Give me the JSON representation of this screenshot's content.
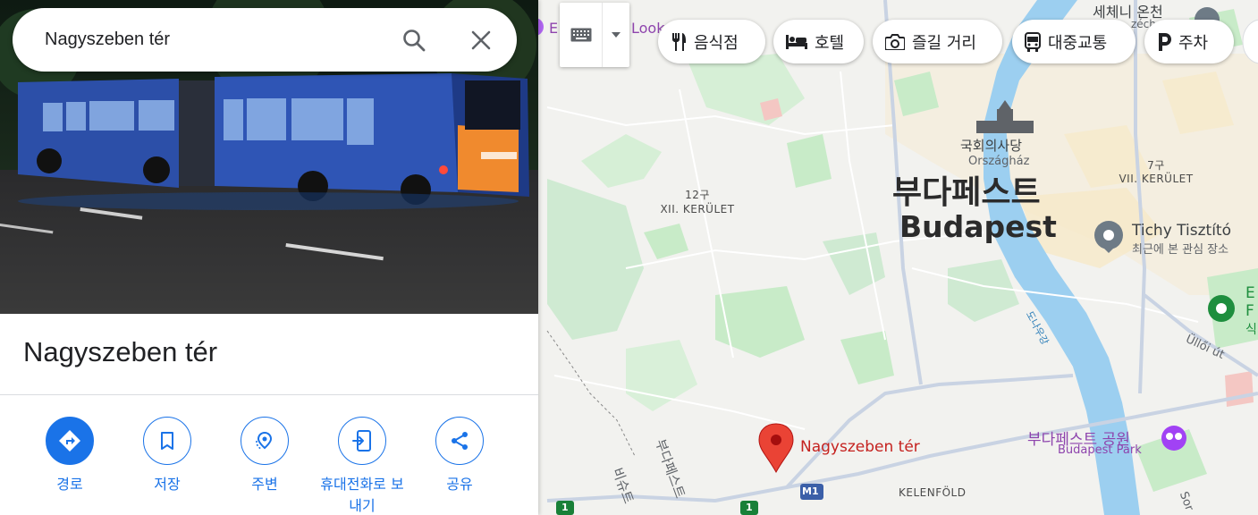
{
  "search": {
    "value": "Nagyszeben tér"
  },
  "place": {
    "title": "Nagyszeben tér"
  },
  "actions": [
    {
      "label": "경로"
    },
    {
      "label": "저장"
    },
    {
      "label": "주변"
    },
    {
      "label": "휴대전화로 보\n내기"
    },
    {
      "label": "공유"
    }
  ],
  "chips": [
    {
      "label": "음식점",
      "icon": "fork-knife-icon"
    },
    {
      "label": "호텔",
      "icon": "bed-icon"
    },
    {
      "label": "즐길 거리",
      "icon": "camera-icon"
    },
    {
      "label": "대중교통",
      "icon": "bus-icon"
    },
    {
      "label": "주차",
      "icon": "parking-icon"
    }
  ],
  "map": {
    "top_left_purple": "E",
    "top_left_purple2": "Look",
    "district_12_num": "12구",
    "district_12": "XII. KERÜLET",
    "district_7_num": "7구",
    "district_7": "VII. KERÜLET",
    "city_ko": "부다페스트",
    "city_en": "Budapest",
    "parliament_ko": "국회의사당",
    "parliament_hu": "Országház",
    "szechenyi": "세체니 온천",
    "szechenyi_sub": "zécho",
    "tichy": "Tichy Tisztító",
    "tichy_sub": "최근에 본 관심 장소",
    "park_ko": "부다페스트 공원",
    "park_en": "Budapest Park",
    "river": "도나우강",
    "ulloi": "Üllői út",
    "kelenfold": "KELENFÖLD",
    "motorway": "M1",
    "route1": "1",
    "pin_label": "Nagyszeben tér",
    "right_edge_1": "E",
    "right_edge_2": "F",
    "right_edge_3": "식",
    "soroksari": "Sor",
    "budaors_1": "부다페스트",
    "budaors_2": "비슈트",
    "colors": {
      "water": "#9ccff0",
      "green": "#c8ebc8",
      "road": "#ffffff",
      "major_road": "#c9d3e3",
      "pin": "#ea4335",
      "accent": "#1a73e8"
    }
  }
}
